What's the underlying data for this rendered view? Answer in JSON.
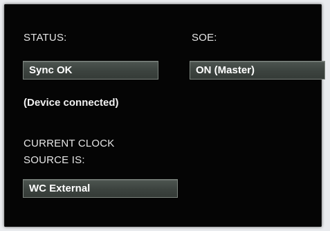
{
  "status": {
    "label": "STATUS:",
    "value": "Sync OK",
    "note": "(Device connected)"
  },
  "soe": {
    "label": "SOE:",
    "value": "ON (Master)"
  },
  "clock": {
    "label_line1": "CURRENT CLOCK",
    "label_line2": "SOURCE IS:",
    "value": "WC External"
  }
}
